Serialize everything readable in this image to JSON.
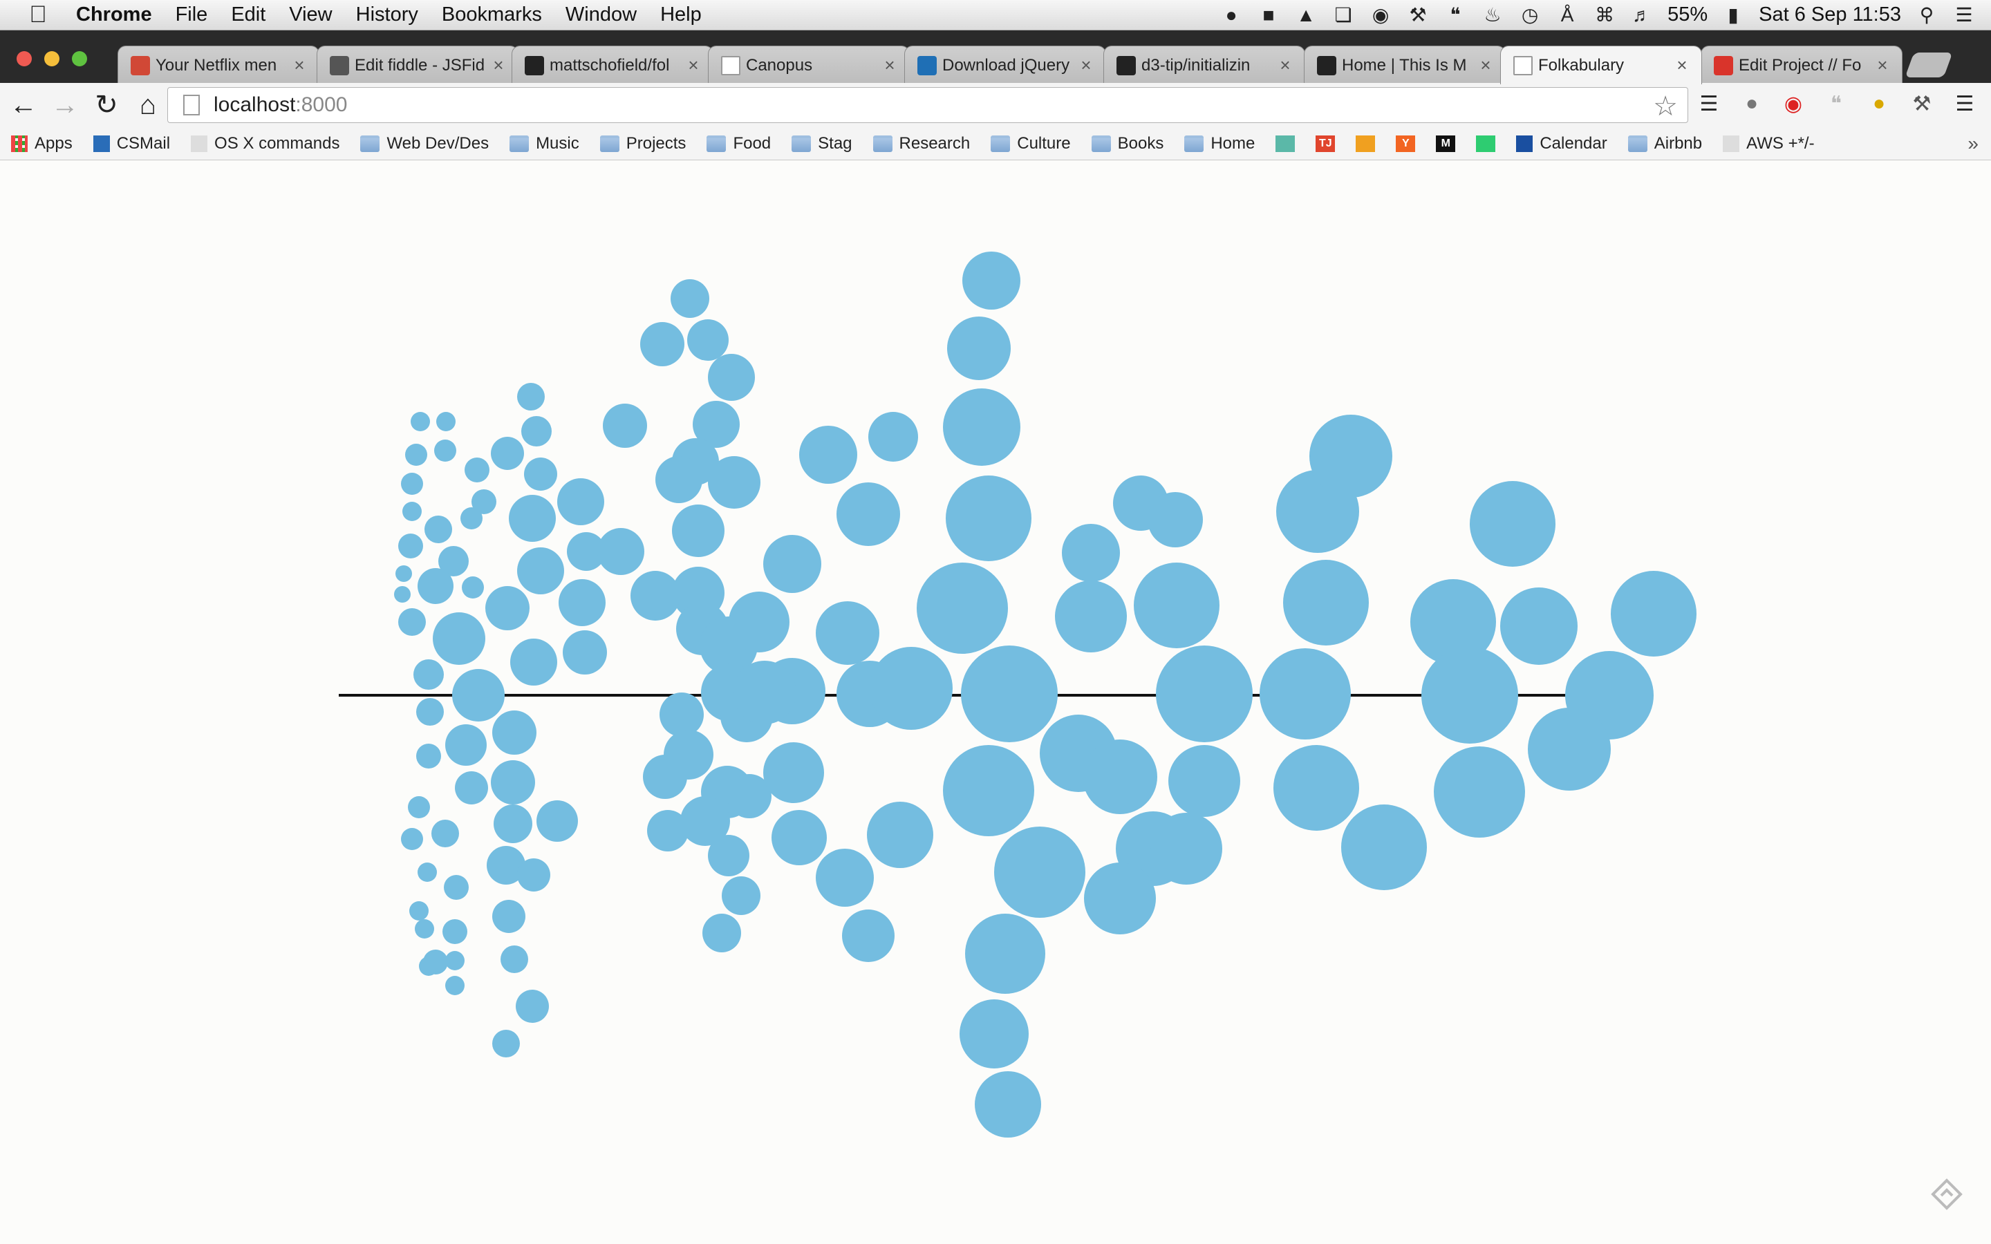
{
  "menubar": {
    "app_name": "Chrome",
    "items": [
      "File",
      "Edit",
      "View",
      "History",
      "Bookmarks",
      "Window",
      "Help"
    ],
    "battery": "55%",
    "datetime": "Sat 6 Sep  11:53"
  },
  "tabs": [
    {
      "title": "Your Netflix men",
      "icon": "gmail-icon",
      "color": "#d14836"
    },
    {
      "title": "Edit fiddle - JSFid",
      "icon": "jsfiddle-icon",
      "color": "#555555"
    },
    {
      "title": "mattschofield/fol",
      "icon": "github-icon",
      "color": "#222222"
    },
    {
      "title": "Canopus",
      "icon": "page-icon",
      "color": "#ffffff"
    },
    {
      "title": "Download jQuery",
      "icon": "jquery-icon",
      "color": "#1f6fb5"
    },
    {
      "title": "d3-tip/initializin",
      "icon": "github-icon",
      "color": "#222222"
    },
    {
      "title": "Home | This Is M",
      "icon": "jam-icon",
      "color": "#222222"
    },
    {
      "title": "Folkabulary",
      "icon": "page-icon",
      "color": "#ffffff",
      "active": true
    },
    {
      "title": "Edit Project // Fo",
      "icon": "project-icon",
      "color": "#d9342b"
    }
  ],
  "address": {
    "host": "localhost",
    "port": ":8000"
  },
  "bookmarks": [
    {
      "label": "Apps",
      "icon": "apps-grid-icon"
    },
    {
      "label": "CSMail",
      "icon": "mail-icon"
    },
    {
      "label": "OS X commands",
      "icon": "page-icon"
    },
    {
      "label": "Web Dev/Des",
      "icon": "folder-icon"
    },
    {
      "label": "Music",
      "icon": "folder-icon"
    },
    {
      "label": "Projects",
      "icon": "folder-icon"
    },
    {
      "label": "Food",
      "icon": "folder-icon"
    },
    {
      "label": "Stag",
      "icon": "folder-icon"
    },
    {
      "label": "Research",
      "icon": "folder-icon"
    },
    {
      "label": "Culture",
      "icon": "folder-icon"
    },
    {
      "label": "Books",
      "icon": "folder-icon"
    },
    {
      "label": "Home",
      "icon": "folder-icon"
    },
    {
      "label": "",
      "icon": "stamp-icon"
    },
    {
      "label": "",
      "icon": "tj-icon",
      "text": "TJ"
    },
    {
      "label": "",
      "icon": "box-icon"
    },
    {
      "label": "",
      "icon": "ycombinator-icon",
      "text": "Y"
    },
    {
      "label": "",
      "icon": "medium-icon",
      "text": "M"
    },
    {
      "label": "",
      "icon": "green-square-icon"
    },
    {
      "label": "Calendar",
      "icon": "calendar-icon"
    },
    {
      "label": "Airbnb",
      "icon": "folder-icon"
    },
    {
      "label": "AWS +*/-",
      "icon": "page-icon"
    }
  ],
  "viz": {
    "bubble_color": "#74bde0",
    "axis_color": "#111111"
  }
}
